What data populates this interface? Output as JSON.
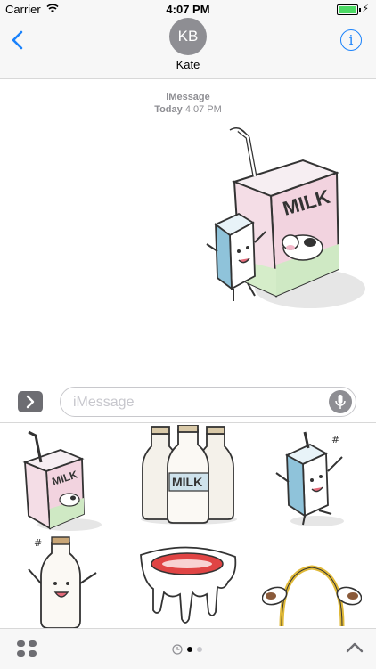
{
  "status_bar": {
    "carrier": "Carrier",
    "time": "4:07 PM"
  },
  "navbar": {
    "avatar_initials": "KB",
    "contact_name": "Kate",
    "info_label": "i"
  },
  "thread": {
    "service": "iMessage",
    "day": "Today",
    "time": "4:07 PM",
    "sent_sticker": "milk-carton-with-small-milk-carton-and-cow"
  },
  "composer": {
    "placeholder": "iMessage"
  },
  "sticker_drawer": {
    "stickers": [
      "pink-milk-carton-cow",
      "three-milk-bottles",
      "waving-milk-carton",
      "waving-milk-bottle",
      "dripping-milk-mouth",
      "cow-ears-headband"
    ]
  },
  "colors": {
    "accent": "#1a82fb",
    "battery": "#4cd964",
    "bar": "#f7f7f7"
  }
}
